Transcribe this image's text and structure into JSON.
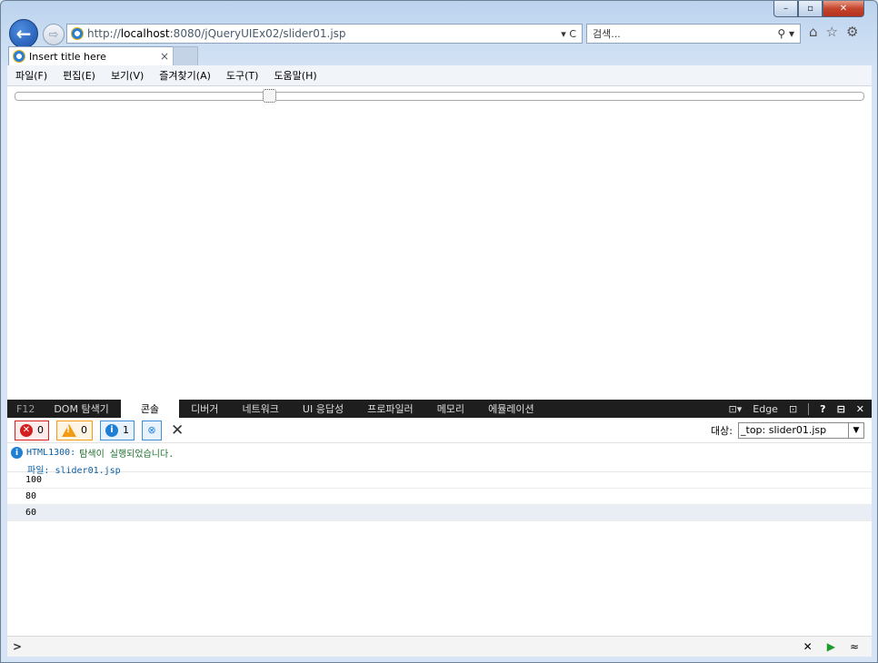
{
  "browser": {
    "url_prefix": "http://",
    "url_host": "localhost",
    "url_rest": ":8080/jQueryUIEx02/slider01.jsp",
    "refresh_glyph": "▾ C",
    "search_placeholder": "검색...",
    "search_glyph": "⚲ ▾",
    "caption": {
      "minimize": "–",
      "restore": "▫",
      "close": "✕"
    },
    "nav": {
      "back": "←",
      "forward": "⇨"
    },
    "icons": {
      "home": "⌂",
      "favorites": "☆",
      "settings": "⚙"
    }
  },
  "tab": {
    "title": "Insert title here",
    "close": "×"
  },
  "menu": [
    "파일(F)",
    "편집(E)",
    "보기(V)",
    "즐겨찾기(A)",
    "도구(T)",
    "도움말(H)"
  ],
  "slider": {
    "value": 30,
    "min": 0,
    "max": 100
  },
  "devtools": {
    "f12": "F12",
    "tabs": [
      "DOM 탐색기",
      "콘솔",
      "디버거",
      "네트워크",
      "UI 응답성",
      "프로파일러",
      "메모리",
      "에뮬레이션"
    ],
    "active_tab": "콘솔",
    "mode_label": "Edge",
    "right_icons": {
      "device": "⊡▾",
      "console_toggle": "⊡",
      "help": "?",
      "undock": "⊟",
      "close": "✕"
    },
    "filters": {
      "errors": "0",
      "warnings": "0",
      "info": "1"
    },
    "target_label": "대상:",
    "target_value": "_top: slider01.jsp",
    "messages": {
      "code": "HTML1300:",
      "text": "탐색이 실행되었습니다.",
      "file_label": "파일:",
      "file": "slider01.jsp"
    },
    "logs": [
      "100",
      "80",
      "60"
    ],
    "prompt": ">",
    "footer_icons": {
      "clear": "✕",
      "run": "▶",
      "expand": "≈"
    }
  },
  "colors": {
    "accent": "#1f7fd4",
    "devtools_bar": "#1e1e1e",
    "error": "#d31f1f",
    "warning": "#f39a16",
    "success": "#1d9a2b"
  }
}
